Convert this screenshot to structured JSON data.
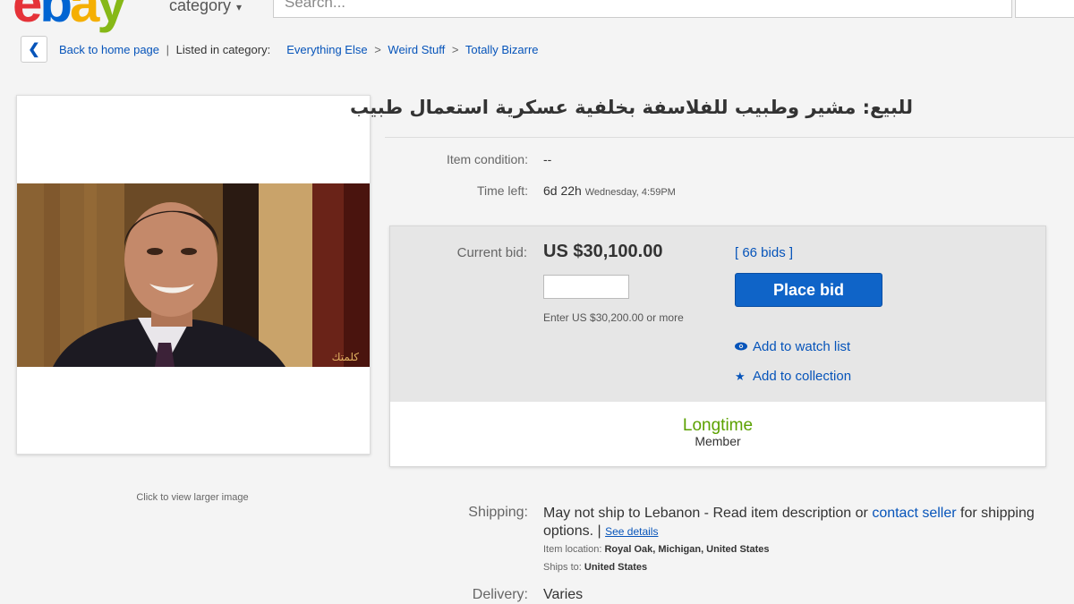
{
  "header": {
    "logo_letters": [
      "e",
      "b",
      "a",
      "y"
    ],
    "category_label": "category",
    "search_placeholder": "Search..."
  },
  "breadcrumb": {
    "back_label": "Back to home page",
    "listed_label": "Listed in category:",
    "items": [
      "Everything Else",
      "Weird Stuff",
      "Totally Bizarre"
    ],
    "separator": ">"
  },
  "listing": {
    "title": "للبيع: مشير وطبيب للفلاسفة بخلفية عسكرية استعمال طبيب",
    "image_caption": "Click to view larger image",
    "image_watermark": "كلمتك",
    "item_condition_label": "Item condition:",
    "item_condition_value": "--",
    "time_left_label": "Time left:",
    "time_left_value": "6d 22h",
    "time_left_detail": "Wednesday, 4:59PM"
  },
  "bidding": {
    "current_bid_label": "Current bid:",
    "current_bid_value": "US $30,100.00",
    "bids_count_label": "[ 66 bids ]",
    "place_bid_label": "Place bid",
    "bid_hint": "Enter US $30,200.00 or more",
    "watch_list_label": "Add to watch list",
    "collection_label": "Add to collection",
    "seller_badge_title": "Longtime",
    "seller_badge_subtitle": "Member"
  },
  "shipping": {
    "label": "Shipping:",
    "text_before": "May not ship to Lebanon - Read item description or ",
    "contact_link": "contact seller",
    "text_after": " for shipping options. | ",
    "see_details": "See details",
    "item_location_label": "Item location:",
    "item_location_value": "Royal Oak, Michigan, United States",
    "ships_to_label": "Ships to:",
    "ships_to_value": "United States",
    "delivery_label": "Delivery:",
    "delivery_value": "Varies"
  },
  "colors": {
    "link": "#0654ba",
    "place_bid_bg": "#0f64c8",
    "longtime_green": "#5ba100",
    "panel_gray": "#e6e6e6"
  },
  "icons": [
    "chevron-left-icon",
    "eye-icon",
    "star-icon",
    "caret-down-icon"
  ]
}
